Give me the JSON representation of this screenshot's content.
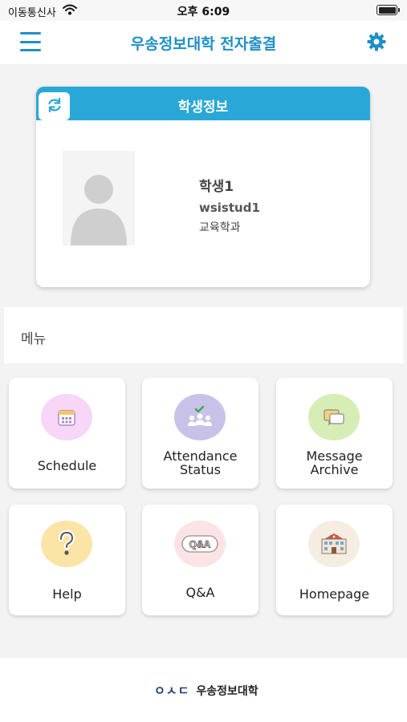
{
  "status_bar": {
    "carrier": "이동통신사",
    "time": "오후 6:09"
  },
  "header": {
    "title": "우송정보대학 전자출결",
    "menu_icon": "hamburger-icon",
    "settings_icon": "gear-icon"
  },
  "student_card": {
    "title": "학생정보",
    "refresh_icon": "refresh-icon",
    "name": "학생1",
    "student_id": "wsistud1",
    "department": "교육학과"
  },
  "menu": {
    "label": "메뉴",
    "tiles": [
      {
        "label": "Schedule",
        "icon": "calendar-icon",
        "color": "#f7d6f7"
      },
      {
        "label_line1": "Attendance",
        "label_line2": "Status",
        "icon": "attendance-group-icon",
        "color": "#c9c2e8"
      },
      {
        "label_line1": "Message",
        "label_line2": "Archive",
        "icon": "message-icon",
        "color": "#d6edb6"
      },
      {
        "label": "Help",
        "icon": "question-icon",
        "color": "#fbe4a6"
      },
      {
        "label": "Q&A",
        "icon": "qna-icon",
        "color": "#fbe3e6"
      },
      {
        "label": "Homepage",
        "icon": "school-building-icon",
        "color": "#f5ece2"
      }
    ]
  },
  "footer": {
    "logo_mark": "ㅇㅅㄷ",
    "logo_name": "우송정보대학"
  },
  "colors": {
    "accent": "#1e8fc6",
    "card_header": "#29a8d8",
    "background": "#f3f3f3"
  }
}
